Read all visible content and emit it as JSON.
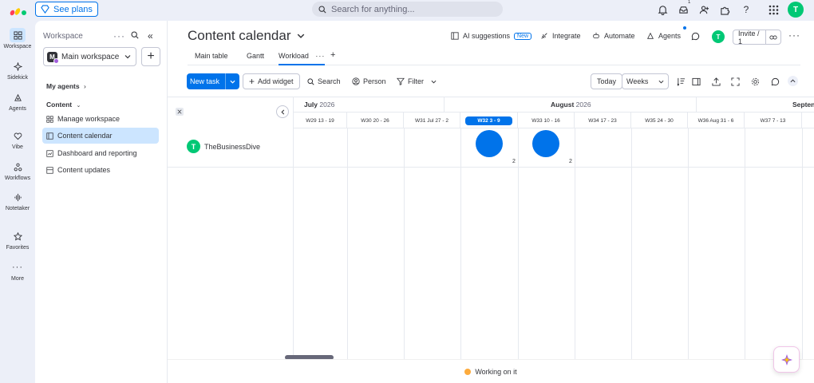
{
  "topbar": {
    "see_plans": "See plans",
    "search_placeholder": "Search for anything...",
    "notif_count": "1",
    "avatar": "T"
  },
  "rail": {
    "items": [
      {
        "label": "Workspace",
        "icon": "workspace-icon"
      },
      {
        "label": "Sidekick",
        "icon": "sidekick-icon"
      },
      {
        "label": "Agents",
        "icon": "agents-icon"
      },
      {
        "label": "Vibe",
        "icon": "vibe-icon"
      },
      {
        "label": "Workflows",
        "icon": "workflows-icon"
      },
      {
        "label": "Notetaker",
        "icon": "notetaker-icon"
      },
      {
        "label": "Favorites",
        "icon": "star-icon"
      },
      {
        "label": "More",
        "icon": "more-icon"
      }
    ]
  },
  "sidebar": {
    "title": "Workspace",
    "workspace_badge": "M",
    "workspace_name": "Main workspace",
    "my_agents": "My agents",
    "content_label": "Content",
    "items": [
      {
        "label": "Manage workspace",
        "icon": "manage-icon"
      },
      {
        "label": "Content calendar",
        "icon": "board-icon"
      },
      {
        "label": "Dashboard and reporting",
        "icon": "dashboard-icon"
      },
      {
        "label": "Content updates",
        "icon": "board-icon"
      }
    ]
  },
  "header": {
    "board_title": "Content calendar",
    "ai_suggestions": "AI suggestions",
    "new_badge": "New",
    "integrate": "Integrate",
    "automate": "Automate",
    "agents": "Agents",
    "avatar": "T",
    "invite": "Invite / 1"
  },
  "tabs": {
    "items": [
      "Main table",
      "Gantt",
      "Workload"
    ],
    "active": "Workload"
  },
  "toolbar": {
    "new_task": "New task",
    "add_widget": "Add widget",
    "search": "Search",
    "person": "Person",
    "filter": "Filter",
    "today": "Today",
    "weeks": "Weeks"
  },
  "workload": {
    "months": [
      {
        "name": "July",
        "year": "2026"
      },
      {
        "name": "August",
        "year": "2026"
      },
      {
        "name": "Septen",
        "year": ""
      }
    ],
    "weeks": [
      "W29 13 - 19",
      "W30 20 - 26",
      "W31 Jul 27 - 2",
      "W32 3 - 9",
      "W33 10 - 16",
      "W34 17 - 23",
      "W35 24 - 30",
      "W36 Aug 31 - 6",
      "W37 7 - 13"
    ],
    "current_week": "W32 3 - 9",
    "person": {
      "initial": "T",
      "name": "TheBusinessDive",
      "color": "#00c875"
    },
    "bubbles": [
      {
        "week": "W32 3 - 9",
        "count": "2"
      },
      {
        "week": "W33 10 - 16",
        "count": "2"
      }
    ]
  },
  "footer": {
    "status_label": "Working on it",
    "status_color": "#fdab3d"
  },
  "colors": {
    "accent": "#0073ea",
    "success": "#00c875"
  }
}
